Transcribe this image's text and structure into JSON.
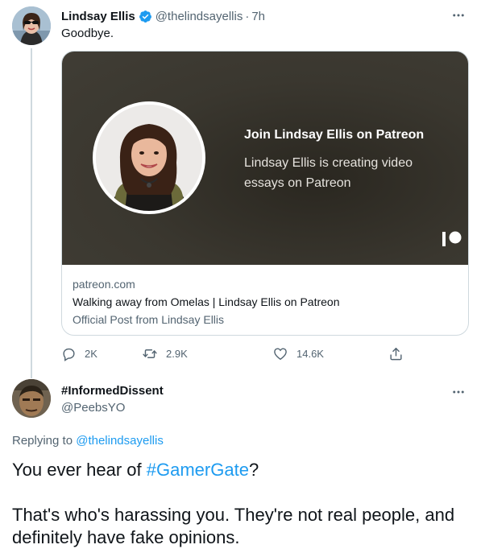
{
  "tweet": {
    "author_name": "Lindsay Ellis",
    "author_handle": "@thelindsayellis",
    "separator": "·",
    "time": "7h",
    "text": "Goodbye.",
    "card": {
      "title": "Join Lindsay Ellis on Patreon",
      "description": "Lindsay Ellis is creating video essays on Patreon",
      "domain": "patreon.com",
      "headline": "Walking away from Omelas | Lindsay Ellis on Patreon",
      "subtitle": "Official Post from Lindsay Ellis"
    },
    "stats": {
      "replies": "2K",
      "retweets": "2.9K",
      "likes": "14.6K"
    }
  },
  "reply": {
    "author_name": "#InformedDissent",
    "author_handle": "@PeebsYO",
    "replying_prefix": "Replying to ",
    "replying_to": "@thelindsayellis",
    "line1_before": "You ever hear of ",
    "hashtag": "#GamerGate",
    "line1_after": "?",
    "line2": "That's who's harassing you. They're not real people, and definitely have fake opinions."
  },
  "colors": {
    "link": "#1d9bf0",
    "secondary_text": "#536471",
    "primary_text": "#0f1419",
    "card_bg": "#3a372f"
  }
}
